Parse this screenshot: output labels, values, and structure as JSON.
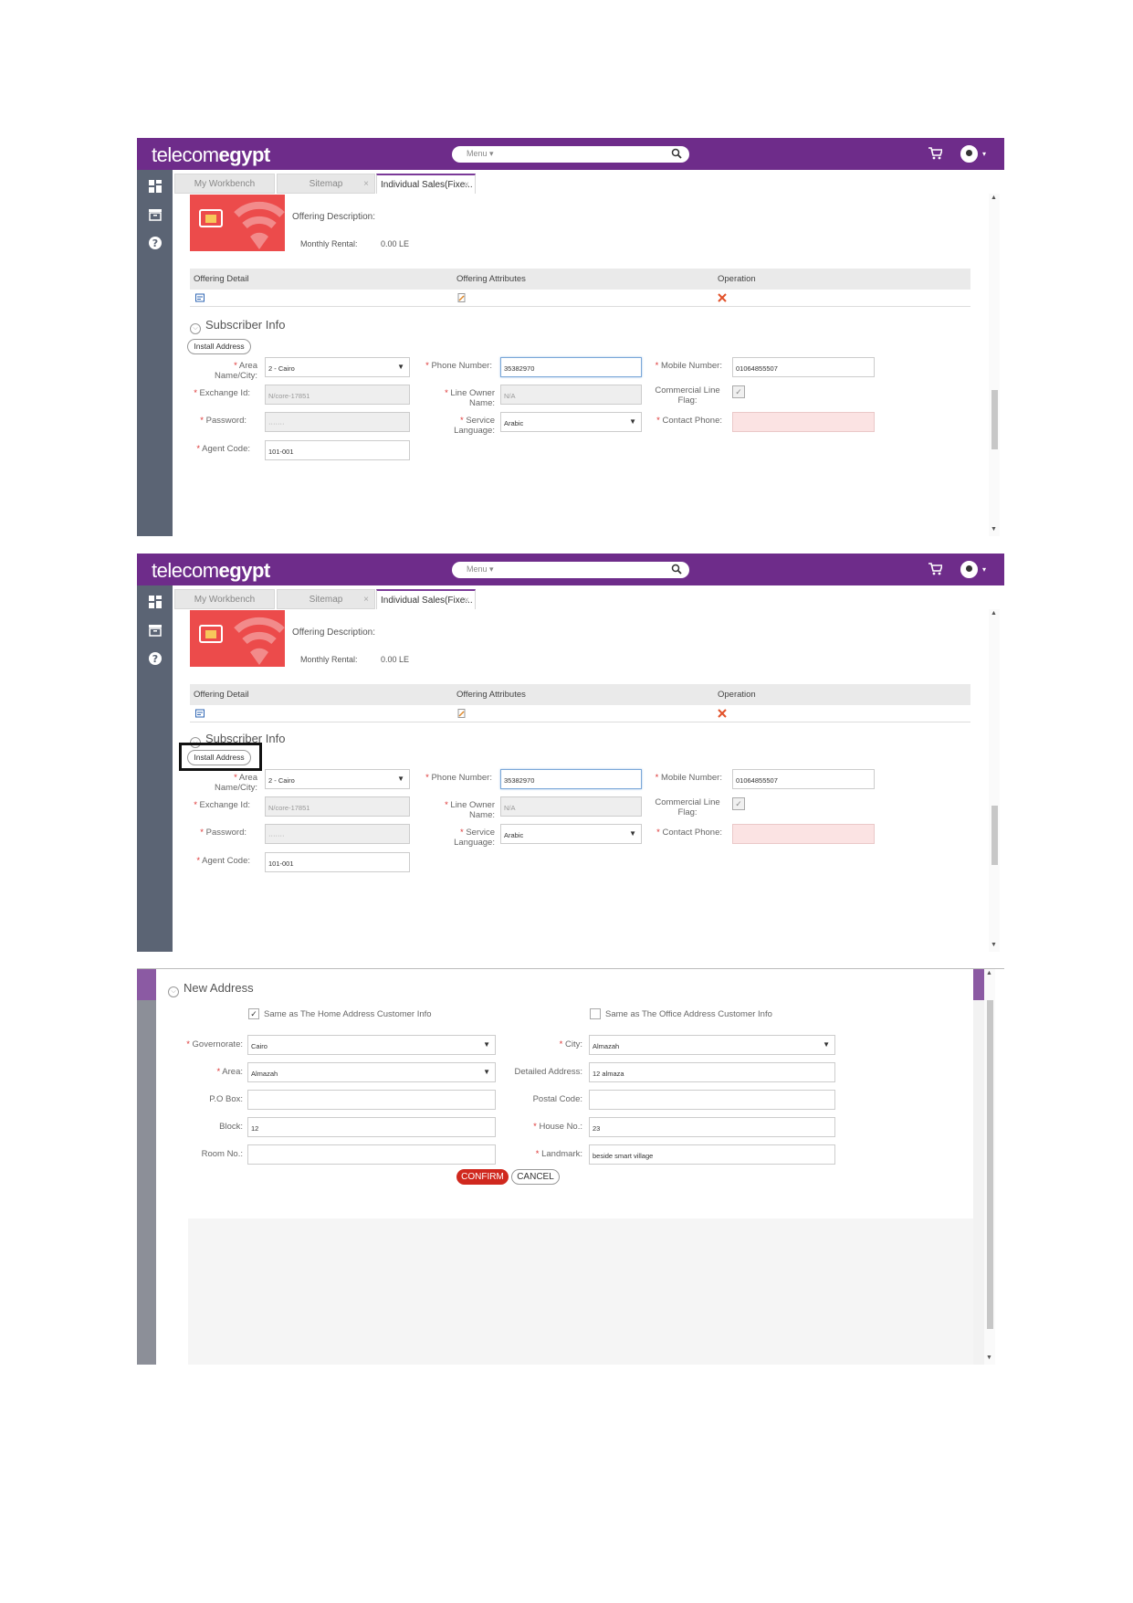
{
  "header": {
    "logo_light": "telecom",
    "logo_bold": "egypt",
    "menu_label": "Menu ▾"
  },
  "tabs": {
    "workbench": "My Workbench",
    "sitemap": "Sitemap",
    "active": "Individual Sales(Fixe...",
    "close": "×"
  },
  "offering": {
    "description_label": "Offering Description:",
    "rental_label": "Monthly Rental:",
    "rental_value": "0.00 LE",
    "col_detail": "Offering Detail",
    "col_attributes": "Offering Attributes",
    "col_operation": "Operation"
  },
  "subscriber": {
    "title": "Subscriber Info",
    "install_button": "Install Address",
    "area_label": "Area Name/City:",
    "area_value": "2 - Cairo",
    "phone_label": "Phone Number:",
    "phone_value": "35382970",
    "mobile_label": "Mobile Number:",
    "mobile_value": "01064855507",
    "exchange_label": "Exchange Id:",
    "exchange_value": "N/core-17851",
    "owner_label": "Line Owner Name:",
    "owner_value": "N/A",
    "commercial_label_1": "Commercial Line",
    "commercial_label_2": "Flag:",
    "password_label": "Password:",
    "password_value": "·······",
    "language_label": "Service Language:",
    "language_value": "Arabic",
    "contact_label": "Contact Phone:",
    "agent_label": "Agent Code:",
    "agent_value": "101-001"
  },
  "new_address": {
    "title": "New Address",
    "same_home": "Same as The Home Address Customer Info",
    "same_office": "Same as The Office Address Customer Info",
    "governorate_label": "Governorate:",
    "governorate_value": "Cairo",
    "city_label": "City:",
    "city_value": "Almazah",
    "area_label": "Area:",
    "area_value": "Almazah",
    "detailed_label": "Detailed Address:",
    "detailed_value": "12 almaza",
    "pobox_label": "P.O Box:",
    "pobox_value": "",
    "postal_label": "Postal Code:",
    "postal_value": "",
    "block_label": "Block:",
    "block_value": "12",
    "house_label": "House No.:",
    "house_value": "23",
    "room_label": "Room No.:",
    "room_value": "",
    "landmark_label": "Landmark:",
    "landmark_value": "beside smart village",
    "confirm": "CONFIRM",
    "cancel": "CANCEL"
  },
  "colors": {
    "topbar": "#6e2c8a",
    "sidebar": "#5b6474",
    "confirm": "#d0281e",
    "offer_image": "#ec4b4b"
  }
}
